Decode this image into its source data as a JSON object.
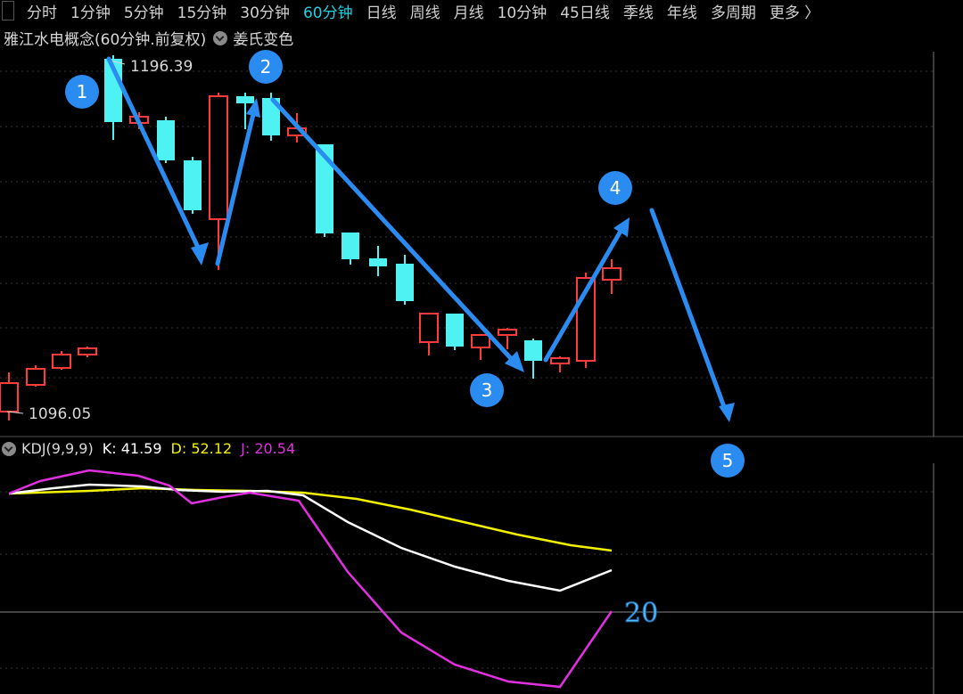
{
  "toolbar": {
    "tabs": [
      {
        "label": "分时"
      },
      {
        "label": "1分钟"
      },
      {
        "label": "5分钟"
      },
      {
        "label": "15分钟"
      },
      {
        "label": "30分钟"
      },
      {
        "label": "60分钟",
        "active": true
      },
      {
        "label": "日线"
      },
      {
        "label": "周线"
      },
      {
        "label": "月线"
      },
      {
        "label": "10分钟"
      },
      {
        "label": "45日线"
      },
      {
        "label": "季线"
      },
      {
        "label": "年线"
      },
      {
        "label": "多周期"
      },
      {
        "label": "更多 〉"
      }
    ],
    "active_color": "#21d0e0"
  },
  "title": {
    "instrument": "雅江水电概念(60分钟.前复权)",
    "scheme": "姜氏变色"
  },
  "price": {
    "high_label": "1196.39",
    "low_label": "1096.05"
  },
  "kdj": {
    "name": "KDJ(9,9,9)",
    "k_label": "K: 41.59",
    "d_label": "D: 52.12",
    "j_label": "J: 20.54",
    "k_color": "#ffffff",
    "d_color": "#f2f200",
    "j_color": "#e030e0",
    "level_label": "20"
  },
  "annotations": {
    "labels": [
      "1",
      "2",
      "3",
      "4",
      "5"
    ],
    "color": "#2a8cf0"
  },
  "colors": {
    "up": "#ff3b3b",
    "down": "#4ff2f2",
    "arrow": "#2a8cf0"
  }
}
